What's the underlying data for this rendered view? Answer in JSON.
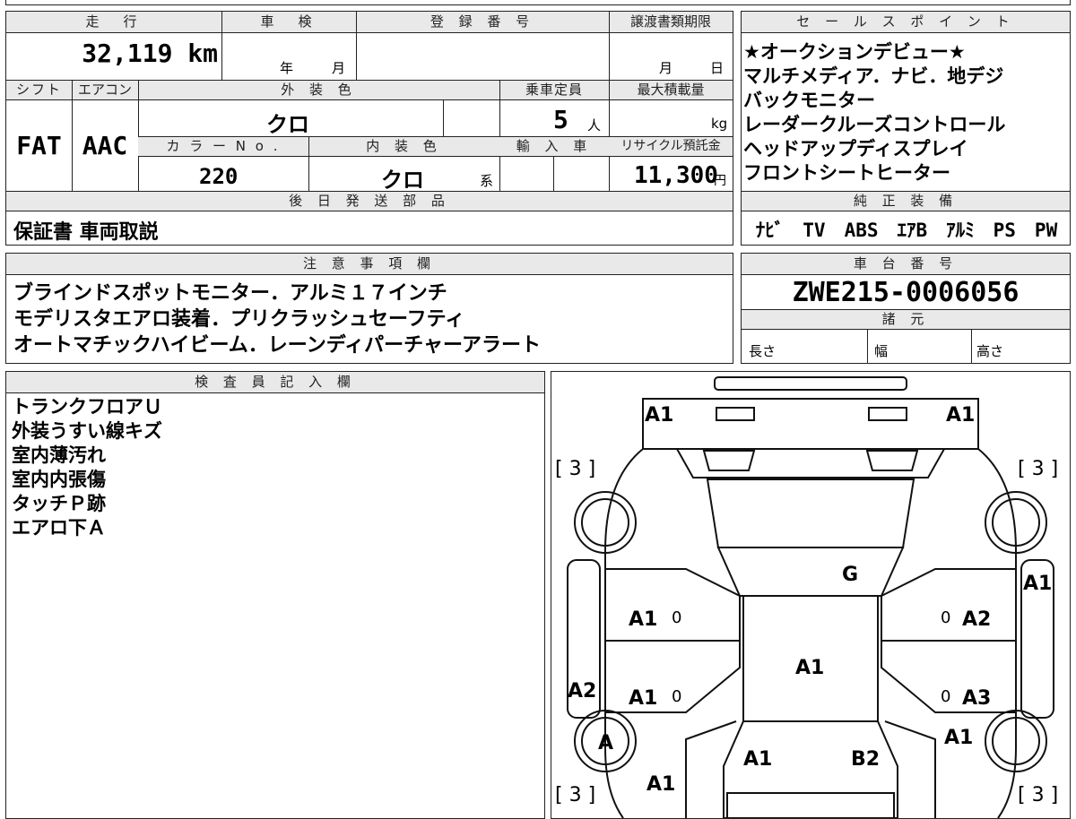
{
  "top_strip": "",
  "main_table": {
    "mileage_header": "走　行",
    "mileage_value": "32,119 km",
    "inspection_header": "車　検",
    "inspection_year": "年",
    "inspection_month": "月",
    "registration_header": "登 録 番 号",
    "transfer_header": "譲渡書類期限",
    "transfer_month": "月",
    "transfer_day": "日",
    "shift_header": "シフト",
    "shift_value": "FAT",
    "ac_header": "エアコン",
    "ac_value": "AAC",
    "exterior_header": "外 装 色",
    "exterior_value": "クロ",
    "capacity_header": "乗車定員",
    "capacity_value": "5",
    "capacity_unit": "人",
    "maxload_header": "最大積載量",
    "maxload_unit": "kg",
    "colorno_header": "カ ラ ー N o .",
    "colorno_value": "220",
    "interior_header": "内 装 色",
    "interior_value": "クロ",
    "interior_unit": "系",
    "import_header": "輸 入 車",
    "recycle_header": "リサイクル預託金",
    "recycle_value": "11,300",
    "recycle_unit": "円",
    "later_parts_header": "後 日 発 送 部 品",
    "later_parts_value": "保証書 車両取説"
  },
  "sales_points": {
    "header": "セ ー ル ス ポ イ ン ト",
    "lines": [
      "★オークションデビュー★",
      "マルチメディア．ナビ．地デジ",
      "バックモニター",
      "レーダークルーズコントロール",
      "ヘッドアップディスプレイ",
      "フロントシートヒーター"
    ],
    "equipment_header": "純 正 装 備",
    "equipment_value": "ﾅﾋﾞ　TV　ABS　ｴｱB　ｱﾙﾐ　PS　PW"
  },
  "notes": {
    "header": "注 意 事 項 欄",
    "lines": [
      "ブラインドスポットモニター．アルミ１７インチ",
      "モデリスタエアロ装着．プリクラッシュセーフティ",
      "オートマチックハイビーム．レーンディパーチャーアラート"
    ]
  },
  "chassis": {
    "header": "車 台 番 号",
    "value": "ZWE215-0006056",
    "spec_header": "諸 元",
    "length_label": "長さ",
    "width_label": "幅",
    "height_label": "高さ"
  },
  "inspector": {
    "header": "検 査 員 記 入 欄",
    "lines": [
      "トランクフロアＵ",
      "外装うすい線キズ",
      "室内薄汚れ",
      "室内内張傷",
      "タッチＰ跡",
      "エアロ下Ａ"
    ]
  },
  "diagram": {
    "marks": {
      "rear_left": "A1",
      "rear_right": "A1",
      "tire_tl": "[ 3 ]",
      "tire_tr": "[ 3 ]",
      "glass": "G",
      "right_fender_rear": "A1",
      "door_rl": "A1",
      "door_rr": "A2",
      "roof": "A1",
      "door_fl": "A1",
      "door_fr": "A3",
      "left_fender": "A2",
      "wheel_fl": "A",
      "right_front": "A1",
      "hood_left": "A1",
      "hood_right": "B2",
      "front_left": "A1",
      "tire_bl": "[ 3 ]",
      "tire_br": "[ 3 ]",
      "zero": "0"
    }
  }
}
